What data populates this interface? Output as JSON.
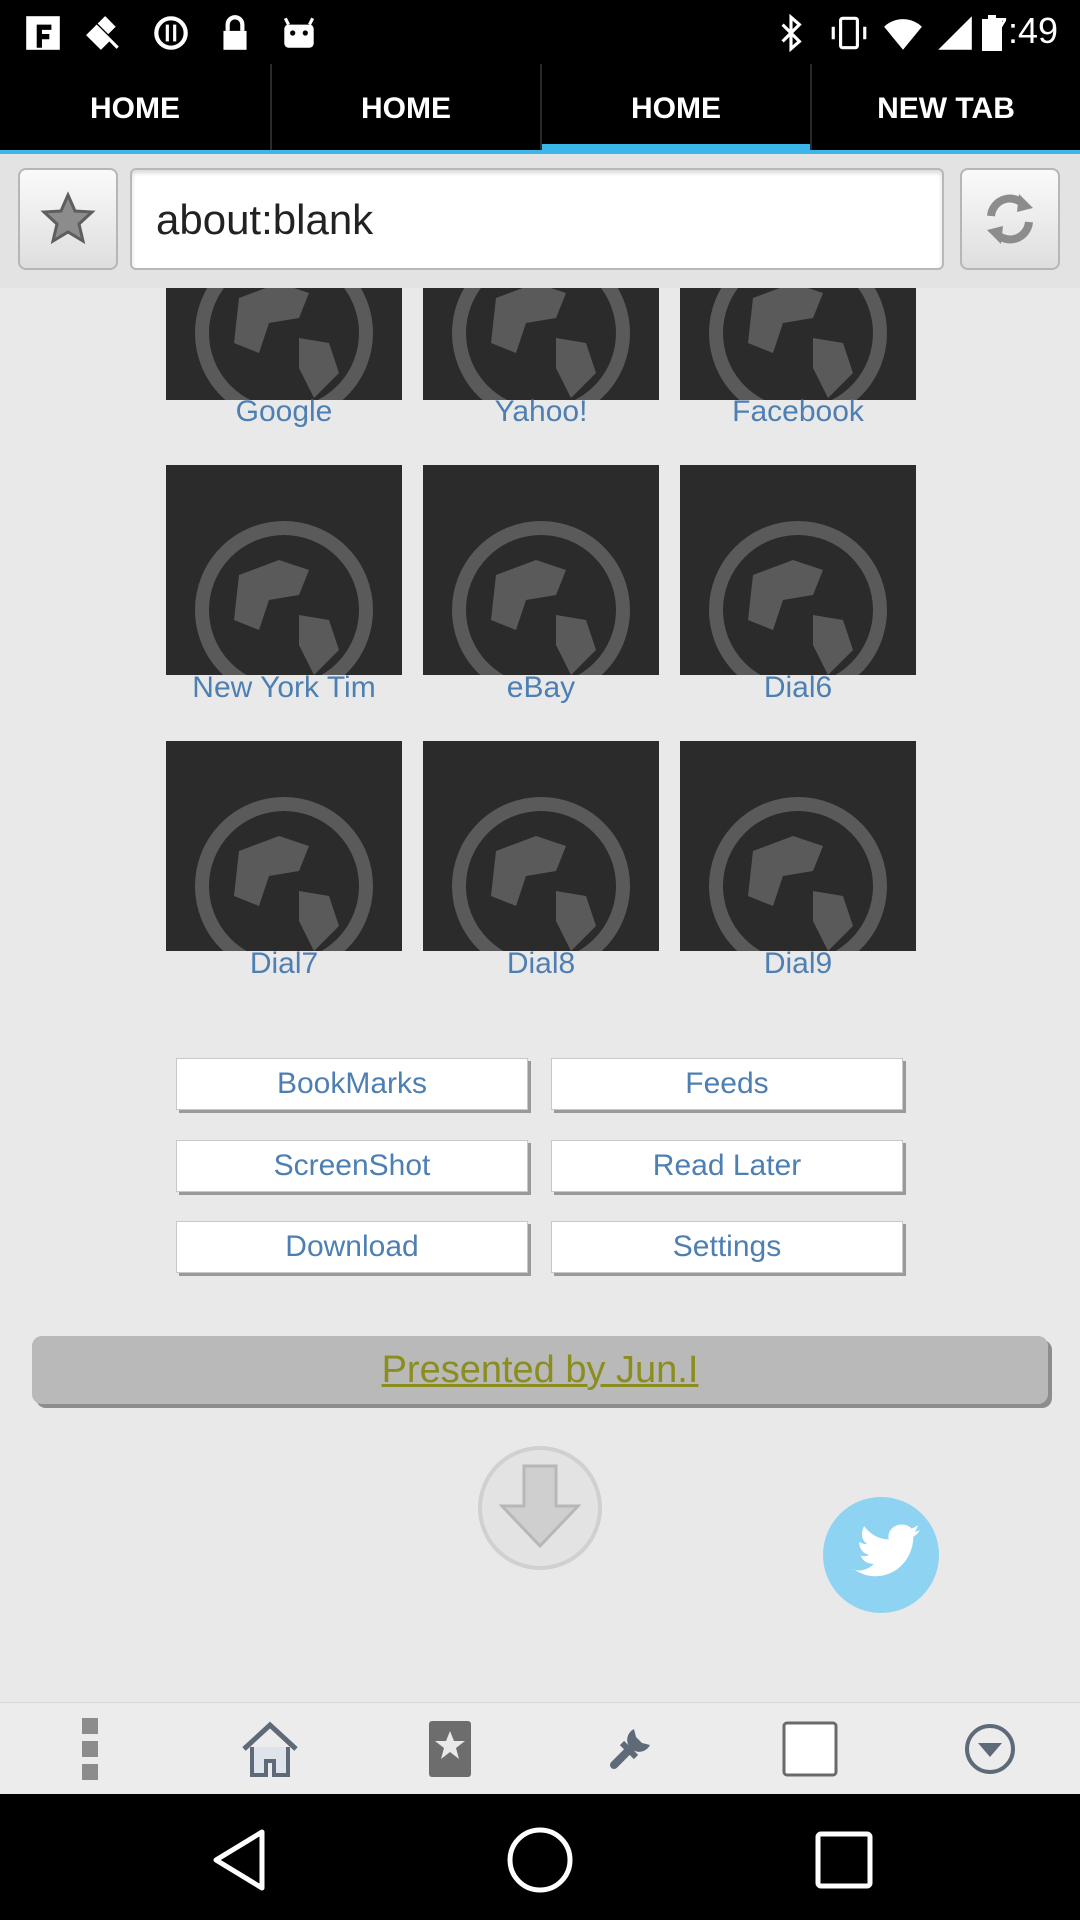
{
  "status_bar": {
    "time": "7:49",
    "left_icons": [
      "fake-gps-icon",
      "satellite-icon",
      "sync-icon",
      "lock-icon",
      "android-icon"
    ],
    "right_icons": [
      "bluetooth-icon",
      "vibrate-icon",
      "wifi-icon",
      "signal-icon",
      "battery-icon"
    ]
  },
  "tabs": [
    {
      "label": "HOME",
      "active": false
    },
    {
      "label": "HOME",
      "active": false
    },
    {
      "label": "HOME",
      "active": true
    },
    {
      "label": "NEW TAB",
      "active": false
    }
  ],
  "address_bar": {
    "url": "about:blank",
    "left_button_icon": "star-icon",
    "right_button_icon": "refresh-icon"
  },
  "speed_dial": [
    {
      "label": "Google"
    },
    {
      "label": "Yahoo!"
    },
    {
      "label": "Facebook"
    },
    {
      "label": "New York Tim"
    },
    {
      "label": "eBay"
    },
    {
      "label": "Dial6"
    },
    {
      "label": "Dial7"
    },
    {
      "label": "Dial8"
    },
    {
      "label": "Dial9"
    }
  ],
  "menu_buttons": [
    {
      "label": "BookMarks"
    },
    {
      "label": "Feeds"
    },
    {
      "label": "ScreenShot"
    },
    {
      "label": "Read Later"
    },
    {
      "label": "Download"
    },
    {
      "label": "Settings"
    }
  ],
  "footer": {
    "presented_by": "Presented by Jun.I",
    "icons": [
      "download-arrow-icon",
      "twitter-bird-icon"
    ]
  },
  "toolbar": {
    "icons": [
      "overflow-menu-icon",
      "home-icon",
      "bookmark-icon",
      "wrench-icon",
      "tabs-square-icon",
      "dropdown-circle-icon"
    ]
  },
  "navigation": {
    "icons": [
      "back-icon",
      "home-circle-icon",
      "recents-icon"
    ]
  },
  "colors": {
    "accent": "#3ab7e8",
    "link": "#4e7fb2",
    "presented": "#8b8d1e",
    "twitter": "#8fd3f2"
  }
}
